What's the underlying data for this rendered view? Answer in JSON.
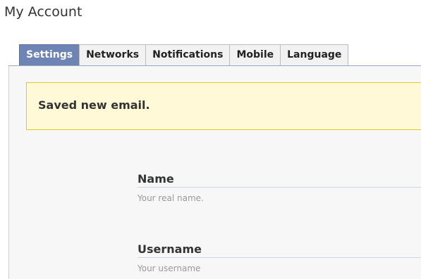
{
  "page": {
    "title": "My Account"
  },
  "tabs": [
    {
      "label": "Settings",
      "active": true
    },
    {
      "label": "Networks",
      "active": false
    },
    {
      "label": "Notifications",
      "active": false
    },
    {
      "label": "Mobile",
      "active": false
    },
    {
      "label": "Language",
      "active": false
    }
  ],
  "notice": {
    "message": "Saved new email."
  },
  "fields": {
    "name": {
      "label": "Name",
      "hint": "Your real name."
    },
    "username": {
      "label": "Username",
      "hint": "Your username"
    }
  },
  "colors": {
    "active_tab": "#6d84b4",
    "notice_bg": "#fff9d7",
    "notice_border": "#e2c822"
  }
}
